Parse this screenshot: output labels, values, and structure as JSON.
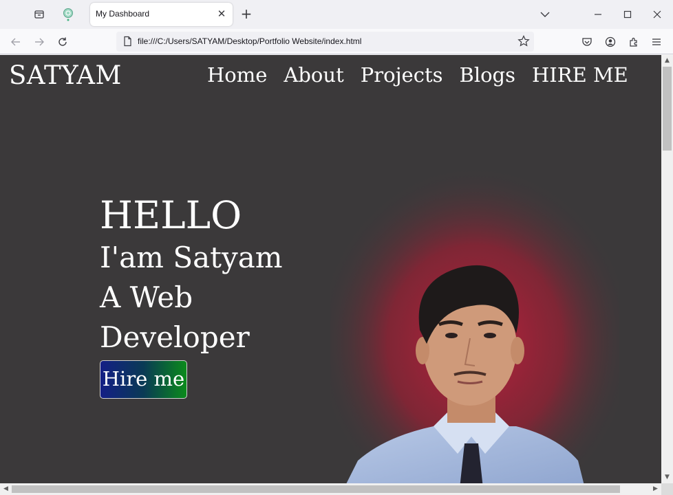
{
  "browser": {
    "tab_title": "My Dashboard",
    "url": "file:///C:/Users/SATYAM/Desktop/Portfolio Website/index.html",
    "icons": [
      "sidebar-icon",
      "extension-tab-icon",
      "close-icon",
      "plus-icon",
      "chevron-down-icon",
      "minimize-icon",
      "maximize-icon",
      "window-close-icon",
      "back-icon",
      "forward-icon",
      "reload-icon",
      "page-icon",
      "star-icon",
      "pocket-icon",
      "account-icon",
      "extensions-icon",
      "menu-icon"
    ]
  },
  "site": {
    "logo": "SATYAM",
    "nav": [
      "Home",
      "About",
      "Projects",
      "Blogs",
      "HIRE ME"
    ],
    "hero": {
      "hello": "HELLO",
      "line1": "I'am Satyam",
      "line2": "A Web",
      "line3": "Developer",
      "button": "Hire me"
    },
    "colors": {
      "background": "#3b393a",
      "button_gradient_start": "#141f86",
      "button_gradient_end": "#0b8a1b",
      "portrait_glow": "#c2203d"
    }
  }
}
